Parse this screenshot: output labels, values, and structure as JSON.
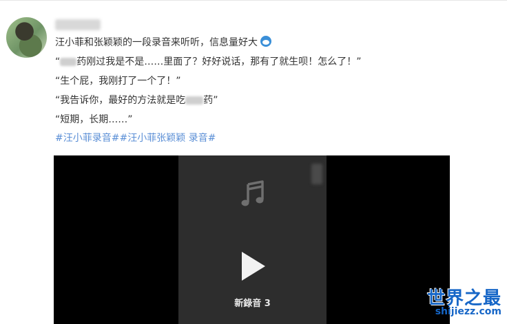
{
  "post": {
    "title_line": "汪小菲和张颖颖的一段录音来听听，信息量好大",
    "emoji": "doraemon-emoji",
    "quote1_open": "“",
    "quote1_rest": "药刚过我是不是……里面了？好好说话，那有了就生呗！怎么了！”",
    "quote2": "“生个屁，我刚打了一个了！”",
    "quote3_start": "“我告诉你，最好的方法就是吃",
    "quote3_end": "药”",
    "quote4": "“短期，长期……”",
    "hashtags": "#汪小菲录音##汪小菲张颖颖 录音#"
  },
  "video": {
    "recording_label": "新錄音 3",
    "music_icon": "music-note-icon",
    "play_icon": "play-icon"
  },
  "watermark": {
    "title": "世界之最",
    "url": "shijiezz.com"
  },
  "colors": {
    "hashtag": "#5b8fd6",
    "video_bg": "#000000",
    "phone_bg": "#2d2d2d",
    "watermark": "#1666c7"
  }
}
